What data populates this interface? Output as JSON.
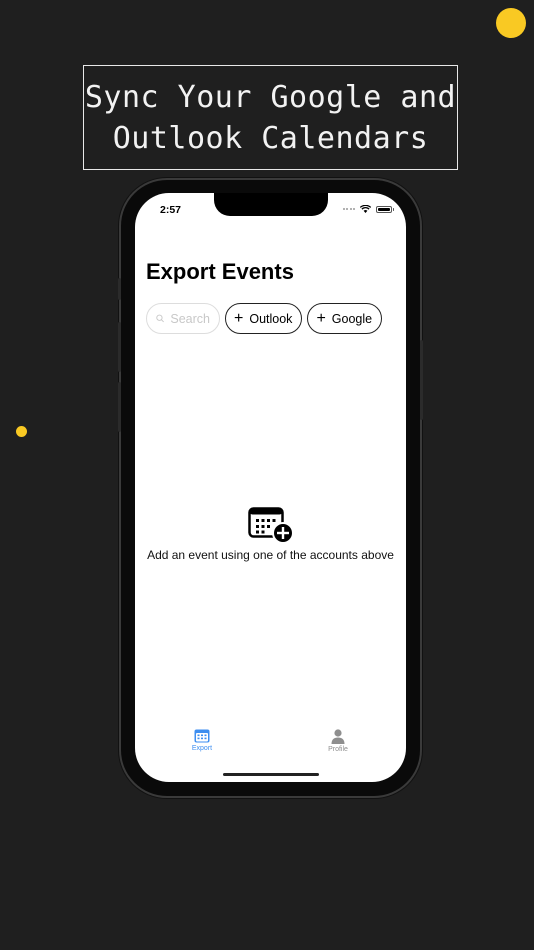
{
  "promo": {
    "headline_line1": "Sync Your Google and",
    "headline_line2": "Outlook Calendars",
    "accent_color": "#f9c923"
  },
  "status_bar": {
    "time": "2:57"
  },
  "screen": {
    "title": "Export Events",
    "search": {
      "placeholder": "Search"
    },
    "chips": [
      {
        "label": "Outlook",
        "icon": "plus-icon"
      },
      {
        "label": "Google",
        "icon": "plus-icon"
      }
    ],
    "empty_state": {
      "icon": "calendar-add-icon",
      "text": "Add an event using one of the accounts above"
    }
  },
  "tab_bar": {
    "tabs": [
      {
        "label": "Export",
        "icon": "calendar-icon",
        "selected": true
      },
      {
        "label": "Profile",
        "icon": "person-icon",
        "selected": false
      }
    ],
    "active_color": "#3d8ef0"
  }
}
